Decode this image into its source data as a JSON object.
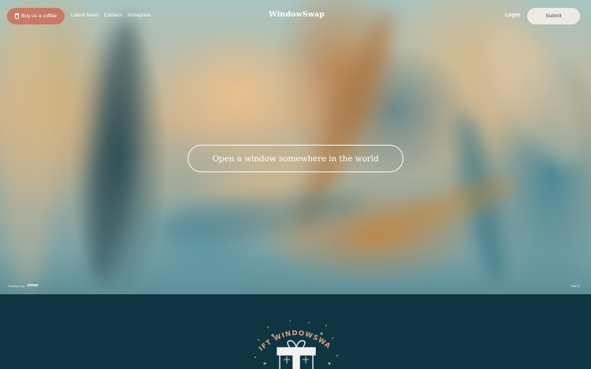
{
  "nav": {
    "coffee_button": "Buy us a coffee",
    "links": [
      "Latest News",
      "Contact",
      "Instagram"
    ],
    "logo": "WindowSwap",
    "login": "Login",
    "submit": "Submit"
  },
  "hero": {
    "cta": "Open a window somewhere in the world",
    "powered_by": "Powered by",
    "vimeo": "vimeo",
    "corner_label": "T&C's"
  },
  "footer": {
    "gift_text": "GIFT WINDOWSWAP!"
  },
  "colors": {
    "coffee_button_bg": "#c97a66",
    "submit_button_bg": "#ede9e4",
    "footer_bg": "#0f3542",
    "gift_text": "#e0a080"
  }
}
